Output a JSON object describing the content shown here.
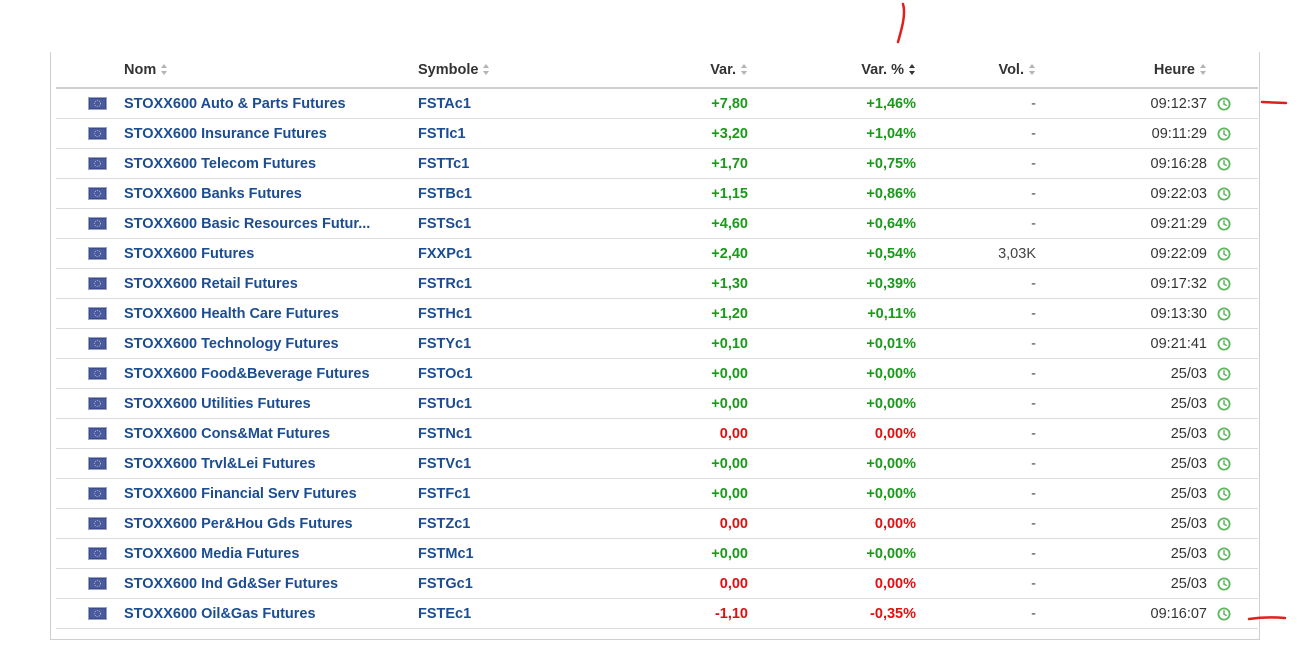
{
  "header": {
    "name": "Nom",
    "symbol": "Symbole",
    "var": "Var.",
    "var_pct": "Var. %",
    "vol": "Vol.",
    "time": "Heure"
  },
  "colors": {
    "positive": "#1a9a1a",
    "negative": "#e01010",
    "link": "#1c4d91",
    "clock": "#5cb85c",
    "annotation": "#e0201c"
  },
  "icons": {
    "flag": "eu-flag-icon",
    "clock": "clock-icon",
    "sort": "sort-arrows-icon"
  },
  "rows": [
    {
      "name": "STOXX600 Auto & Parts Futures",
      "symbol": "FSTAc1",
      "var": "+7,80",
      "var_pct": "+1,46%",
      "vol": "-",
      "time": "09:12:37",
      "dir": "pos"
    },
    {
      "name": "STOXX600 Insurance Futures",
      "symbol": "FSTIc1",
      "var": "+3,20",
      "var_pct": "+1,04%",
      "vol": "-",
      "time": "09:11:29",
      "dir": "pos"
    },
    {
      "name": "STOXX600 Telecom Futures",
      "symbol": "FSTTc1",
      "var": "+1,70",
      "var_pct": "+0,75%",
      "vol": "-",
      "time": "09:16:28",
      "dir": "pos"
    },
    {
      "name": "STOXX600 Banks Futures",
      "symbol": "FSTBc1",
      "var": "+1,15",
      "var_pct": "+0,86%",
      "vol": "-",
      "time": "09:22:03",
      "dir": "pos"
    },
    {
      "name": "STOXX600 Basic Resources Futur...",
      "symbol": "FSTSc1",
      "var": "+4,60",
      "var_pct": "+0,64%",
      "vol": "-",
      "time": "09:21:29",
      "dir": "pos"
    },
    {
      "name": "STOXX600 Futures",
      "symbol": "FXXPc1",
      "var": "+2,40",
      "var_pct": "+0,54%",
      "vol": "3,03K",
      "time": "09:22:09",
      "dir": "pos"
    },
    {
      "name": "STOXX600 Retail Futures",
      "symbol": "FSTRc1",
      "var": "+1,30",
      "var_pct": "+0,39%",
      "vol": "-",
      "time": "09:17:32",
      "dir": "pos"
    },
    {
      "name": "STOXX600 Health Care Futures",
      "symbol": "FSTHc1",
      "var": "+1,20",
      "var_pct": "+0,11%",
      "vol": "-",
      "time": "09:13:30",
      "dir": "pos"
    },
    {
      "name": "STOXX600 Technology Futures",
      "symbol": "FSTYc1",
      "var": "+0,10",
      "var_pct": "+0,01%",
      "vol": "-",
      "time": "09:21:41",
      "dir": "pos"
    },
    {
      "name": "STOXX600 Food&Beverage Futures",
      "symbol": "FSTOc1",
      "var": "+0,00",
      "var_pct": "+0,00%",
      "vol": "-",
      "time": "25/03",
      "dir": "pos"
    },
    {
      "name": "STOXX600 Utilities Futures",
      "symbol": "FSTUc1",
      "var": "+0,00",
      "var_pct": "+0,00%",
      "vol": "-",
      "time": "25/03",
      "dir": "pos"
    },
    {
      "name": "STOXX600 Cons&Mat Futures",
      "symbol": "FSTNc1",
      "var": "0,00",
      "var_pct": "0,00%",
      "vol": "-",
      "time": "25/03",
      "dir": "neg"
    },
    {
      "name": "STOXX600 Trvl&Lei Futures",
      "symbol": "FSTVc1",
      "var": "+0,00",
      "var_pct": "+0,00%",
      "vol": "-",
      "time": "25/03",
      "dir": "pos"
    },
    {
      "name": "STOXX600 Financial Serv Futures",
      "symbol": "FSTFc1",
      "var": "+0,00",
      "var_pct": "+0,00%",
      "vol": "-",
      "time": "25/03",
      "dir": "pos"
    },
    {
      "name": "STOXX600 Per&Hou Gds Futures",
      "symbol": "FSTZc1",
      "var": "0,00",
      "var_pct": "0,00%",
      "vol": "-",
      "time": "25/03",
      "dir": "neg"
    },
    {
      "name": "STOXX600 Media Futures",
      "symbol": "FSTMc1",
      "var": "+0,00",
      "var_pct": "+0,00%",
      "vol": "-",
      "time": "25/03",
      "dir": "pos"
    },
    {
      "name": "STOXX600 Ind Gd&Ser Futures",
      "symbol": "FSTGc1",
      "var": "0,00",
      "var_pct": "0,00%",
      "vol": "-",
      "time": "25/03",
      "dir": "neg"
    },
    {
      "name": "STOXX600 Oil&Gas Futures",
      "symbol": "FSTEc1",
      "var": "-1,10",
      "var_pct": "-0,35%",
      "vol": "-",
      "time": "09:16:07",
      "dir": "neg"
    }
  ]
}
